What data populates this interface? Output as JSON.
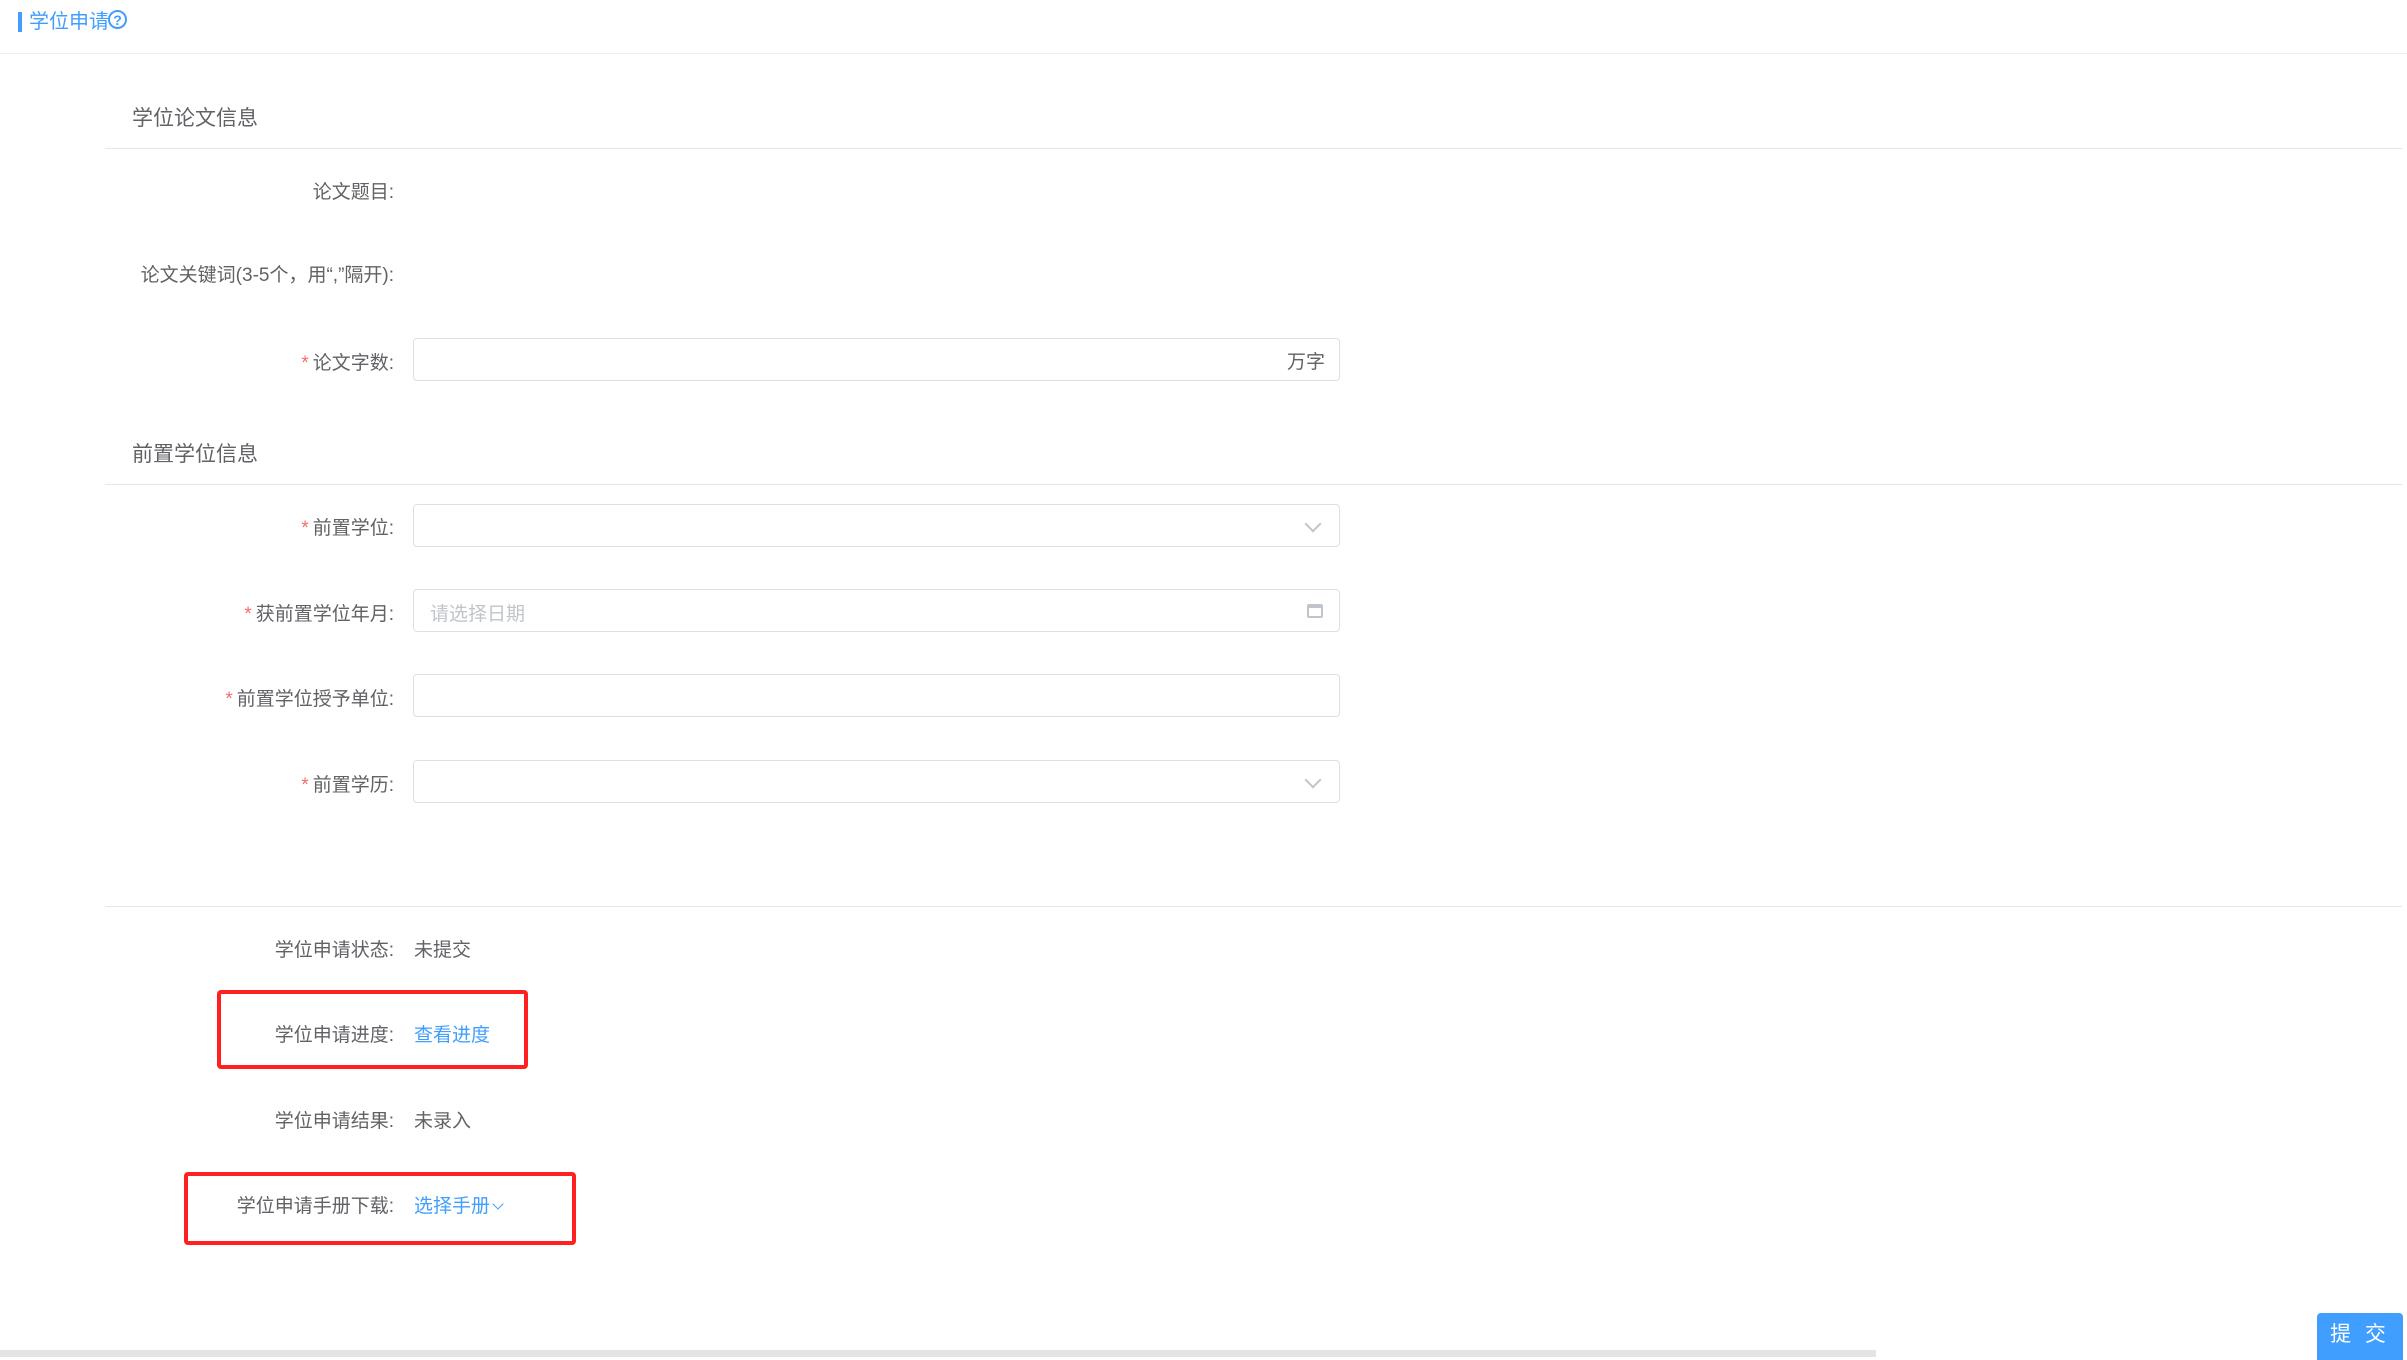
{
  "header": {
    "title": "学位申请",
    "help_icon": "question-circle-icon"
  },
  "thesis_section": {
    "title": "学位论文信息",
    "topic_label": "论文题目:",
    "keywords_label": "论文关键词(3-5个，用“,”隔开):",
    "word_count_label": "论文字数:",
    "word_count_value": "",
    "word_count_suffix": "万字"
  },
  "prior_section": {
    "title": "前置学位信息",
    "degree_label": "前置学位:",
    "degree_value": "",
    "degree_date_label": "获前置学位年月:",
    "degree_date_placeholder": "请选择日期",
    "granting_unit_label": "前置学位授予单位:",
    "granting_unit_value": "",
    "education_label": "前置学历:",
    "education_value": ""
  },
  "status_section": {
    "status_label": "学位申请状态:",
    "status_value": "未提交",
    "progress_label": "学位申请进度:",
    "progress_link": "查看进度",
    "result_label": "学位申请结果:",
    "result_value": "未录入",
    "manual_label": "学位申请手册下载:",
    "manual_link": "选择手册"
  },
  "footer": {
    "submit_label": "提 交"
  },
  "colors": {
    "primary": "#409eff",
    "required": "#f56c6c",
    "highlight_box": "#ff2020"
  }
}
